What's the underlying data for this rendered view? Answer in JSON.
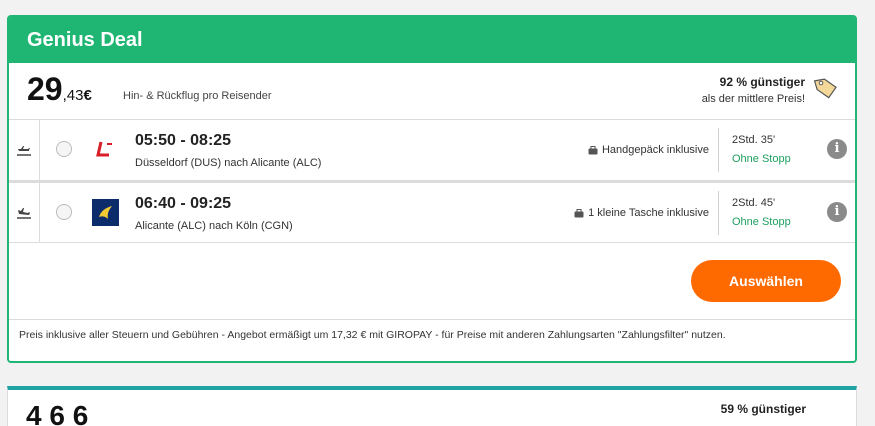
{
  "deal": {
    "title": "Genius Deal",
    "price_int": "29",
    "price_dec": ",43",
    "currency": "€",
    "price_sub": "Hin- & Rückflug pro Reisender",
    "saving_main": "92 % günstiger",
    "saving_sub": "als der mittlere Preis!"
  },
  "flights": [
    {
      "times": "05:50 - 08:25",
      "route": "Düsseldorf (DUS) nach Alicante (ALC)",
      "baggage": "Handgepäck inklusive",
      "duration": "2Std. 35'",
      "stops": "Ohne Stopp"
    },
    {
      "times": "06:40 - 09:25",
      "route": "Alicante (ALC) nach Köln (CGN)",
      "baggage": "1 kleine Tasche inklusive",
      "duration": "2Std. 45'",
      "stops": "Ohne Stopp"
    }
  ],
  "action": {
    "select_label": "Auswählen"
  },
  "footnote": "Preis inklusive aller Steuern und Gebühren - Angebot ermäßigt um 17,32 € mit GIROPAY - für Preise mit anderen Zahlungsarten \"Zahlungsfilter\" nutzen.",
  "next_card": {
    "price": "4 6 6",
    "saving": "59 % günstiger"
  },
  "colors": {
    "green": "#1fb573",
    "orange": "#ff6a00",
    "teal": "#1fa3a3",
    "stops_green": "#1fa05f"
  }
}
